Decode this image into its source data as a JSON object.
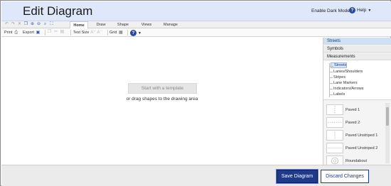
{
  "header": {
    "title": "Edit Diagram",
    "dark_mode_label": "Enable Dark Mode",
    "help_label": "Help"
  },
  "tabs": [
    {
      "label": "Home",
      "active": true
    },
    {
      "label": "Draw",
      "active": false
    },
    {
      "label": "Shape",
      "active": false
    },
    {
      "label": "Views",
      "active": false
    },
    {
      "label": "Manage",
      "active": false
    }
  ],
  "toolbar": {
    "print_label": "Print",
    "export_label": "Export",
    "text_size_label": "Text Size",
    "grid_label": "Grid"
  },
  "canvas": {
    "template_button": "Start with a template",
    "hint": "or drag shapes to the drawing area"
  },
  "panel": {
    "sections": [
      "Streets",
      "Symbols",
      "Measurements"
    ],
    "active_section": "Streets",
    "tree": [
      "Streets",
      "Lanes/Shoulders",
      "Stripes",
      "Lane Markers",
      "Indicators/Arrows",
      "Labels"
    ],
    "shapes": [
      "Paved 1",
      "Paved 2",
      "Paved Unstriped 1",
      "Paved Unstriped 2",
      "Roundabout"
    ]
  },
  "footer": {
    "save_label": "Save Diagram",
    "discard_label": "Discard Changes"
  },
  "colors": {
    "header_bg": "#dfe8fb",
    "accent": "#1f3a86",
    "panel_active": "#cfe0f5"
  }
}
